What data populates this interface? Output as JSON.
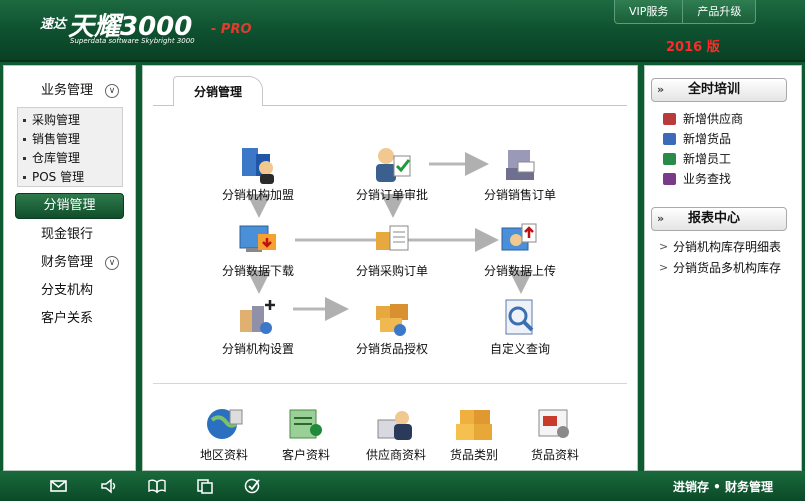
{
  "header": {
    "logo_small": "速达",
    "logo_main": "天耀3000",
    "logo_pro": "- PRO",
    "logo_sub": "Superdata software Skybright 3000",
    "menu": [
      "VIP服务",
      "产品升级"
    ],
    "version": "2016 版"
  },
  "sidebar": {
    "group1": "业务管理",
    "group1_items": [
      "采购管理",
      "销售管理",
      "仓库管理",
      "POS 管理"
    ],
    "active": "分销管理",
    "cash": "现金银行",
    "group2": "财务管理",
    "branch": "分支机构",
    "customer": "客户关系"
  },
  "center": {
    "tab": "分销管理",
    "flow": [
      {
        "label": "分销机构加盟",
        "icon": "org-join-icon"
      },
      {
        "label": "分销订单审批",
        "icon": "order-approve-icon"
      },
      {
        "label": "分销销售订单",
        "icon": "sales-order-icon"
      },
      {
        "label": "分销数据下载",
        "icon": "data-download-icon"
      },
      {
        "label": "分销采购订单",
        "icon": "purchase-order-icon"
      },
      {
        "label": "分销数据上传",
        "icon": "data-upload-icon"
      },
      {
        "label": "分销机构设置",
        "icon": "org-settings-icon"
      },
      {
        "label": "分销货品授权",
        "icon": "goods-auth-icon"
      },
      {
        "label": "自定义查询",
        "icon": "custom-query-icon"
      }
    ],
    "bottom": [
      {
        "label": "地区资料",
        "icon": "globe-icon"
      },
      {
        "label": "客户资料",
        "icon": "customer-card-icon"
      },
      {
        "label": "供应商资料",
        "icon": "supplier-icon"
      },
      {
        "label": "货品类别",
        "icon": "boxes-icon"
      },
      {
        "label": "货品资料",
        "icon": "goods-doc-icon"
      }
    ]
  },
  "right": {
    "training_title": "全时培训",
    "training_links": [
      "新增供应商",
      "新增货品",
      "新增员工",
      "业务查找"
    ],
    "report_title": "报表中心",
    "report_links": [
      "分销机构库存明细表",
      "分销货品多机构库存"
    ]
  },
  "footer": {
    "icons": [
      "mail-icon",
      "speaker-icon",
      "book-icon",
      "copy-icon",
      "check-icon"
    ],
    "text": "进销存 • 财务管理"
  },
  "colors": {
    "brand_green": "#0f5331",
    "accent_red": "#ff2a2a"
  }
}
